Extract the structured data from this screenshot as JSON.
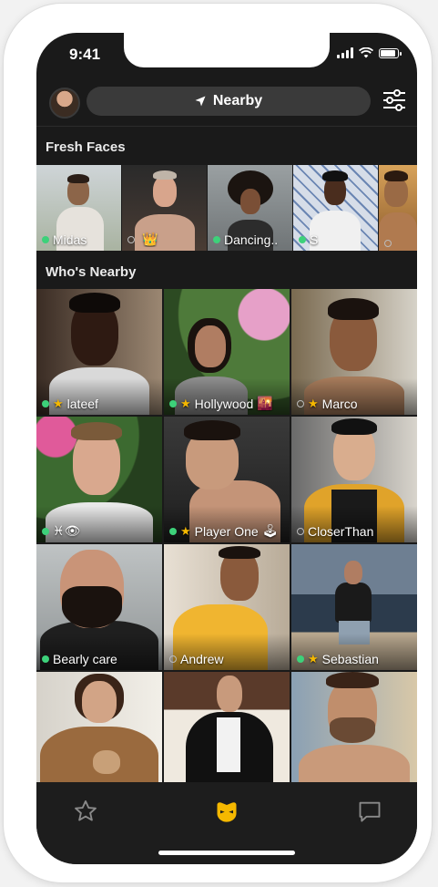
{
  "status_bar": {
    "time": "9:41"
  },
  "header": {
    "location_label": "Nearby",
    "icons": {
      "location": "location-arrow-icon",
      "filter": "filter-sliders-icon"
    }
  },
  "fresh_faces": {
    "title": "Fresh Faces",
    "items": [
      {
        "name": "Midas",
        "online": true,
        "extra": ""
      },
      {
        "name": "",
        "online": false,
        "extra": "👑"
      },
      {
        "name": "Dancing..",
        "online": true,
        "extra": ""
      },
      {
        "name": "S",
        "online": true,
        "extra": ""
      },
      {
        "name": "",
        "online": false,
        "extra": ""
      }
    ]
  },
  "nearby": {
    "title": "Who's Nearby",
    "items": [
      {
        "name": "lateef",
        "online": true,
        "favorite": true,
        "extra": ""
      },
      {
        "name": "Hollywood",
        "online": true,
        "favorite": true,
        "extra": "🌇"
      },
      {
        "name": "Marco",
        "online": false,
        "favorite": true,
        "extra": ""
      },
      {
        "name": "",
        "online": true,
        "favorite": false,
        "extra": "♓👁"
      },
      {
        "name": "Player One",
        "online": true,
        "favorite": true,
        "extra": "🕹"
      },
      {
        "name": "CloserThan",
        "online": false,
        "favorite": false,
        "extra": ""
      },
      {
        "name": "Bearly care",
        "online": true,
        "favorite": false,
        "extra": ""
      },
      {
        "name": "Andrew",
        "online": false,
        "favorite": false,
        "extra": ""
      },
      {
        "name": "Sebastian",
        "online": true,
        "favorite": true,
        "extra": ""
      },
      {
        "name": "",
        "online": false,
        "favorite": false,
        "extra": ""
      },
      {
        "name": "",
        "online": false,
        "favorite": false,
        "extra": ""
      },
      {
        "name": "",
        "online": false,
        "favorite": false,
        "extra": ""
      }
    ]
  },
  "tabbar": {
    "tabs": [
      {
        "icon": "star-outline-icon"
      },
      {
        "icon": "grindr-mask-icon",
        "active": true
      },
      {
        "icon": "chat-bubble-icon"
      }
    ]
  },
  "colors": {
    "accent": "#f5b800",
    "online": "#3dd17a",
    "background": "#1a1a1a"
  }
}
